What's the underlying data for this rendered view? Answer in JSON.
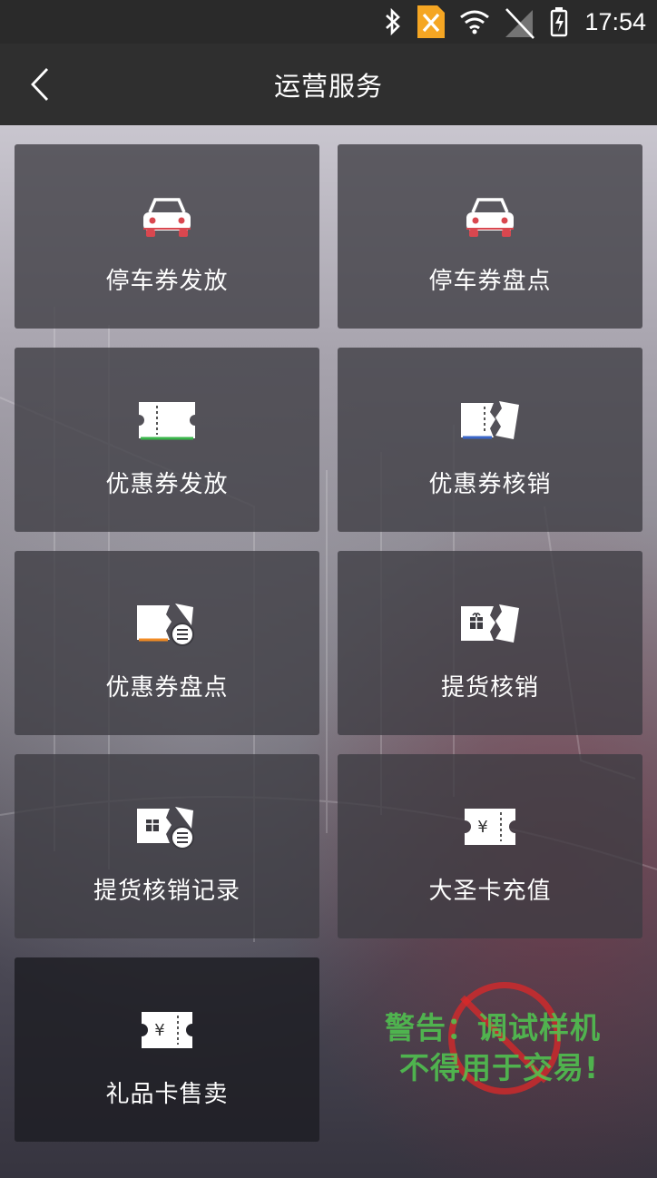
{
  "status_bar": {
    "time": "17:54",
    "icons": [
      "bluetooth-icon",
      "sim-x-icon",
      "wifi-icon",
      "no-signal-icon",
      "battery-icon"
    ],
    "sim_badge_color": "#f5a623"
  },
  "header": {
    "title": "运营服务",
    "back_icon": "chevron-left-icon"
  },
  "tiles": [
    {
      "label": "停车券发放",
      "icon": "car-icon"
    },
    {
      "label": "停车券盘点",
      "icon": "car-icon"
    },
    {
      "label": "优惠券发放",
      "icon": "ticket-icon"
    },
    {
      "label": "优惠券核销",
      "icon": "torn-ticket-icon"
    },
    {
      "label": "优惠券盘点",
      "icon": "ticket-list-icon"
    },
    {
      "label": "提货核销",
      "icon": "gift-ticket-icon"
    },
    {
      "label": "提货核销记录",
      "icon": "gift-ticket-list-icon"
    },
    {
      "label": "大圣卡充值",
      "icon": "yen-card-icon"
    },
    {
      "label": "礼品卡售卖",
      "icon": "yen-card-icon"
    }
  ],
  "watermark": {
    "line1": "警告：调试样机",
    "line2": "不得用于交易!"
  },
  "colors": {
    "car_accent": "#d9474f",
    "ticket_accent_green": "#39b54a",
    "ticket_accent_blue": "#3a66c8",
    "ticket_accent_orange": "#f08a24",
    "warning_green": "#50c850",
    "warning_red": "#dc2828"
  }
}
